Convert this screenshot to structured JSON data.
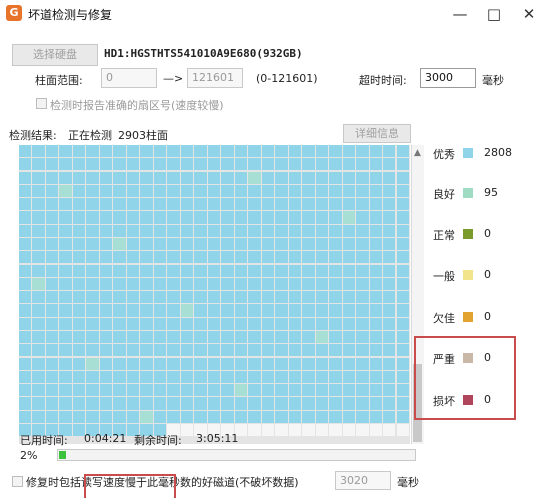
{
  "window": {
    "title": "坏道检测与修复",
    "app_icon_letter": "G"
  },
  "disk": {
    "select_button": "选择硬盘",
    "name": "HD1:HGSTHTS541010A9E680(932GB)"
  },
  "range": {
    "label": "柱面范围:",
    "from": "0",
    "arrow": "—>",
    "to": "121601",
    "hint": "(0-121601)"
  },
  "timeout": {
    "label": "超时时间:",
    "value": "3000",
    "unit": "毫秒"
  },
  "options": {
    "report_sectors": "检测时报告准确的扇区号(速度较慢)"
  },
  "result": {
    "label": "检测结果:",
    "status": "正在检测",
    "cylinder": "2903柱面",
    "details_button": "详细信息"
  },
  "legend": [
    {
      "label": "优秀",
      "count": "2808",
      "color": "#8fd4e8"
    },
    {
      "label": "良好",
      "count": "95",
      "color": "#9fdcc3"
    },
    {
      "label": "正常",
      "count": "0",
      "color": "#7a9a2a"
    },
    {
      "label": "一般",
      "count": "0",
      "color": "#f2e48a"
    },
    {
      "label": "欠佳",
      "count": "0",
      "color": "#e3a331"
    },
    {
      "label": "严重",
      "count": "0",
      "color": "#c9b8a8"
    },
    {
      "label": "损坏",
      "count": "0",
      "color": "#b0445a"
    }
  ],
  "timing": {
    "used_label": "已用时间:",
    "used": "0:04:21",
    "remain_label": "剩余时间:",
    "remain": "3:05:11"
  },
  "progress": {
    "percent_text": "2%",
    "fraction": 0.02
  },
  "repair": {
    "label": "修复时包括读写速度慢于此毫秒数的好磁道(不破坏数据)",
    "value": "3020",
    "unit": "毫秒"
  },
  "accent": {
    "highlight_border": "#c94b4b",
    "progress": "#3cc23c"
  }
}
